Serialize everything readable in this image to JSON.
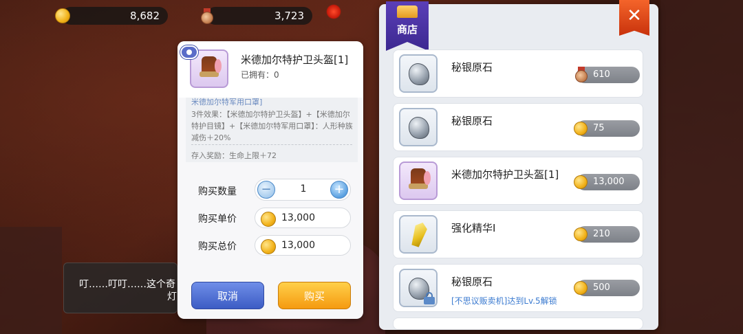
{
  "currency": {
    "gold": "8,682",
    "medal": "3,723"
  },
  "detail": {
    "item_name": "米德加尔特护卫头盔[1]",
    "owned": "已拥有：0",
    "desc_cut": "米德加尔特军用口罩]",
    "set_effect": "3件效果：【米德加尔特护卫头盔】+【米德加尔特护目镜】+【米德加尔特军用口罩】：人形种族减伤＋20%",
    "deposit_reward": "存入奖励：生命上限＋72",
    "qty_label": "购买数量",
    "qty_value": "1",
    "minus": "−",
    "plus": "+",
    "unit_label": "购买单价",
    "unit_price": "13,000",
    "total_label": "购买总价",
    "total_price": "13,000",
    "cancel_label": "取消",
    "buy_label": "购买"
  },
  "notification": {
    "text": "叮……叮叮……这个奇",
    "text_2": "灯"
  },
  "shop": {
    "title": "商店",
    "close": "✕",
    "items": [
      {
        "name": "秘银原石",
        "price": "610",
        "currency": "medal"
      },
      {
        "name": "秘银原石",
        "price": "75",
        "currency": "gold"
      },
      {
        "name": "米德加尔特护卫头盔[1]",
        "price": "13,000",
        "currency": "gold"
      },
      {
        "name": "强化精华Ⅰ",
        "price": "210",
        "currency": "gold"
      },
      {
        "name": "秘银原石",
        "price": "500",
        "currency": "gold",
        "unlock": "[不思议贩卖机]达到Lv.5解锁"
      }
    ]
  }
}
